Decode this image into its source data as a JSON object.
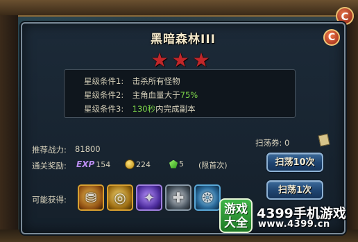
{
  "dialog": {
    "title": "黑暗森林III",
    "close_label": "C",
    "stars": [
      "★",
      "★",
      "★"
    ],
    "conditions": [
      {
        "label": "星级条件1:",
        "text": "击杀所有怪物",
        "highlight": ""
      },
      {
        "label": "星级条件2:",
        "text": "主角血量大于",
        "highlight": "75%"
      },
      {
        "label": "星级条件3:",
        "highlight": "130秒",
        "text": "内完成副本"
      }
    ],
    "sweep_ticket_label": "扫荡券: 0",
    "recommended_power_label": "推荐战力:",
    "recommended_power_value": "81800",
    "clear_reward_label": "通关奖励:",
    "rewards": {
      "exp_label": "EXP",
      "exp_value": "154",
      "gold_value": "224",
      "gem_value": "5",
      "first_clear_note": "(限首次)"
    },
    "sweep10_button": "扫荡10次",
    "sweep1_button": "扫荡1次",
    "possible_drops_label": "可能获得:",
    "drop_items": [
      {
        "name": "gold-bag",
        "glyph": "⛃"
      },
      {
        "name": "gold-coin",
        "glyph": "◎"
      },
      {
        "name": "purple-gem",
        "glyph": "✦"
      },
      {
        "name": "shuriken",
        "glyph": "✚"
      },
      {
        "name": "crystal-orb",
        "glyph": "❂"
      }
    ]
  },
  "outer": {
    "close_label": "C"
  },
  "watermark": {
    "badge": "游戏大全",
    "title": "4399手机游戏",
    "url": "www.4399.cn"
  }
}
